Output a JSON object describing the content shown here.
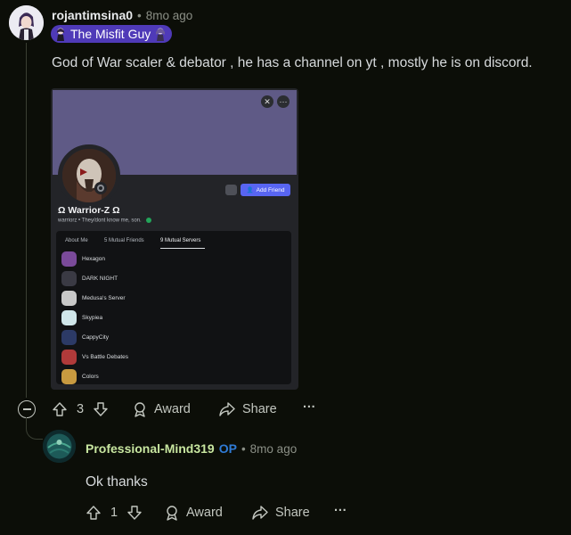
{
  "comment": {
    "username": "rojantimsina0",
    "separator": "•",
    "time": "8mo ago",
    "flair": "The Misfit Guy",
    "text": "God of War scaler & debator , he has a channel on yt , mostly he is on discord.",
    "votes": "3",
    "award_label": "Award",
    "share_label": "Share",
    "more_label": "···"
  },
  "embedded_profile": {
    "add_friend_label": "Add Friend",
    "display_name": "Ω Warrior-Z Ω",
    "subtitle": "warriorz • They/dont know me, son.",
    "tabs": [
      "About Me",
      "5 Mutual Friends",
      "9 Mutual Servers"
    ],
    "servers": [
      {
        "name": "Hexagon",
        "color": "#7a4a9a"
      },
      {
        "name": "DARK NIGHT",
        "color": "#3a3a44"
      },
      {
        "name": "Medusa's Server",
        "color": "#c8c8c8"
      },
      {
        "name": "Skypiea",
        "color": "#d0e6ea"
      },
      {
        "name": "CappyCity",
        "color": "#2c3a66"
      },
      {
        "name": "Vs Battle Debates",
        "color": "#b03a3a"
      },
      {
        "name": "Colors",
        "color": "#c89a40"
      }
    ]
  },
  "reply": {
    "username": "Professional-Mind319",
    "op_badge": "OP",
    "separator": "•",
    "time": "8mo ago",
    "text": "Ok thanks",
    "votes": "1",
    "award_label": "Award",
    "share_label": "Share",
    "more_label": "···"
  },
  "colors": {
    "background": "#0c0e08",
    "flair": "#4f3ab8",
    "op": "#2f7bd6",
    "reply_username": "#c8e6a0",
    "discord_blurple": "#5865f2"
  }
}
